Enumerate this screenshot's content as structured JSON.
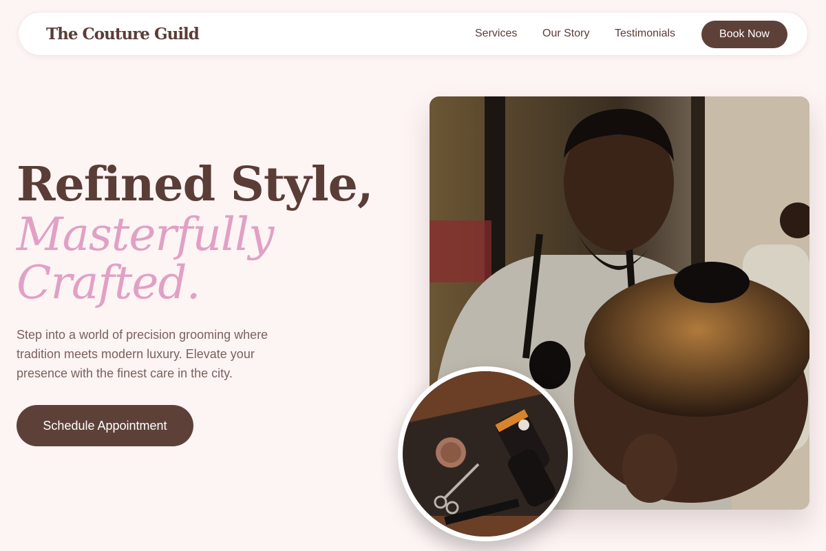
{
  "nav": {
    "brand": "The Couture Guild",
    "links": [
      "Services",
      "Our Story",
      "Testimonials"
    ],
    "cta": "Book Now"
  },
  "hero": {
    "title_line1": "Refined Style,",
    "title_accent": "Masterfully Crafted.",
    "description": "Step into a world of precision grooming where tradition meets modern luxury. Elevate your presence with the finest care in the city.",
    "cta": "Schedule Appointment",
    "main_image_alt": "barber-cutting-hair-photo",
    "detail_image_alt": "barber-tools-flatlay-photo"
  },
  "colors": {
    "background": "#fdf4f4",
    "primary": "#5d4139",
    "accent": "#e0a1c4",
    "text_muted": "#7a625c"
  }
}
